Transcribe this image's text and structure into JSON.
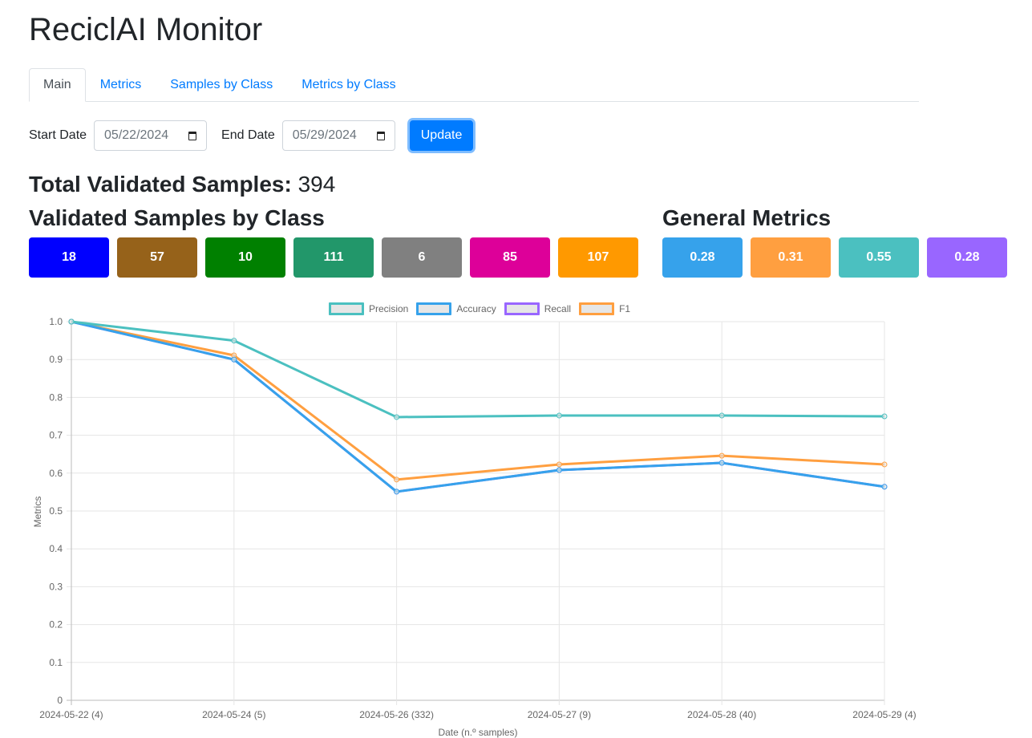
{
  "app": {
    "title": "ReciclAI Monitor"
  },
  "tabs": [
    {
      "label": "Main",
      "active": true
    },
    {
      "label": "Metrics",
      "active": false
    },
    {
      "label": "Samples by Class",
      "active": false
    },
    {
      "label": "Metrics by Class",
      "active": false
    }
  ],
  "filters": {
    "start_label": "Start Date",
    "start_value": "05/22/2024",
    "end_label": "End Date",
    "end_value": "05/29/2024",
    "update_label": "Update"
  },
  "total": {
    "label": "Total Validated Samples:",
    "value": "394"
  },
  "samples_by_class": {
    "title": "Validated Samples by Class",
    "items": [
      {
        "value": "18",
        "color": "#0000ff"
      },
      {
        "value": "57",
        "color": "#96621a"
      },
      {
        "value": "10",
        "color": "#008000"
      },
      {
        "value": "111",
        "color": "#22976a"
      },
      {
        "value": "6",
        "color": "#808080"
      },
      {
        "value": "85",
        "color": "#dd0099"
      },
      {
        "value": "107",
        "color": "#ff9900"
      }
    ]
  },
  "general_metrics": {
    "title": "General Metrics",
    "items": [
      {
        "value": "0.28",
        "color": "#36a2eb"
      },
      {
        "value": "0.31",
        "color": "#ff9f40"
      },
      {
        "value": "0.55",
        "color": "#4bc0c0"
      },
      {
        "value": "0.28",
        "color": "#9966ff"
      }
    ]
  },
  "chart_data": {
    "type": "line",
    "title": "",
    "xlabel": "Date (n.º samples)",
    "ylabel": "Metrics",
    "ylim": [
      0,
      1.0
    ],
    "yticks": [
      "0",
      "0.1",
      "0.2",
      "0.3",
      "0.4",
      "0.5",
      "0.6",
      "0.7",
      "0.8",
      "0.9",
      "1.0"
    ],
    "grid": true,
    "legend_position": "top",
    "categories": [
      "2024-05-22 (4)",
      "2024-05-24 (5)",
      "2024-05-26 (332)",
      "2024-05-27 (9)",
      "2024-05-28 (40)",
      "2024-05-29 (4)"
    ],
    "series": [
      {
        "name": "Precision",
        "color": "#4bc0c0",
        "values": [
          1.0,
          0.95,
          0.748,
          0.752,
          0.752,
          0.75
        ]
      },
      {
        "name": "Accuracy",
        "color": "#36a2eb",
        "values": [
          1.0,
          0.9,
          0.551,
          0.608,
          0.627,
          0.564
        ]
      },
      {
        "name": "Recall",
        "color": "#9966ff",
        "values": [
          1.0,
          0.9,
          0.551,
          0.608,
          0.627,
          0.564
        ]
      },
      {
        "name": "F1",
        "color": "#ff9f40",
        "values": [
          1.0,
          0.911,
          0.583,
          0.623,
          0.646,
          0.623
        ]
      }
    ]
  }
}
